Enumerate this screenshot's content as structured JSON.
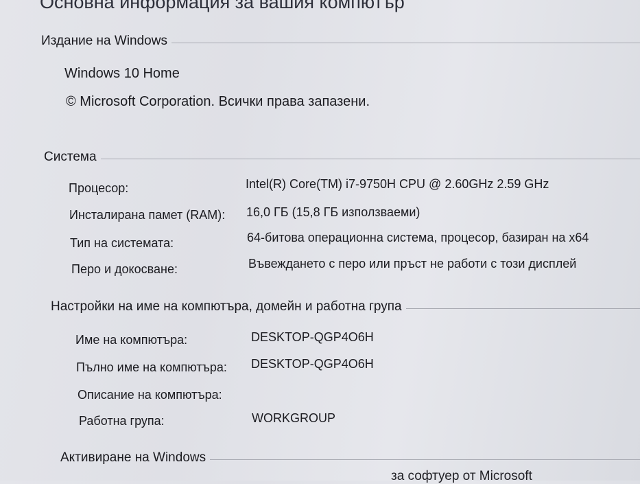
{
  "page_title": "Основна информация за вашия компютър",
  "edition": {
    "header": "Издание на Windows",
    "name": "Windows 10 Home",
    "copyright": "© Microsoft Corporation. Всички права запазени."
  },
  "system": {
    "header": "Система",
    "rows": [
      {
        "label": "Процесор:",
        "value": "Intel(R) Core(TM) i7-9750H CPU @ 2.60GHz   2.59 GHz"
      },
      {
        "label": "Инсталирана памет (RAM):",
        "value": "16,0 ГБ (15,8 ГБ използваеми)"
      },
      {
        "label": "Тип на системата:",
        "value": "64-битова операционна система, процесор, базиран на x64"
      },
      {
        "label": "Перо и докосване:",
        "value": "Въвеждането с перо или пръст не работи с този дисплей"
      }
    ]
  },
  "computer_name": {
    "header": "Настройки на име на компютъра, домейн и работна група",
    "rows": [
      {
        "label": "Име на компютъра:",
        "value": "DESKTOP-QGP4O6H"
      },
      {
        "label": "Пълно име на компютъра:",
        "value": "DESKTOP-QGP4O6H"
      },
      {
        "label": "Описание на компютъра:",
        "value": ""
      },
      {
        "label": "Работна група:",
        "value": "WORKGROUP"
      }
    ]
  },
  "activation": {
    "header": "Активиране на Windows",
    "cut_text": "за софтуер от Microsoft"
  }
}
